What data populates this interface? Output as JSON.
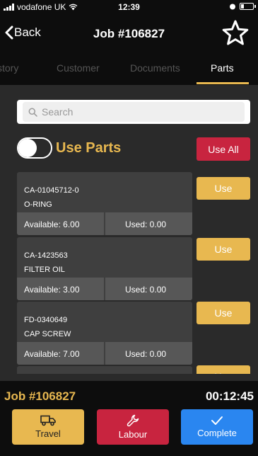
{
  "status_bar": {
    "carrier": "vodafone UK",
    "time": "12:39"
  },
  "nav": {
    "back_label": "Back",
    "title": "Job #106827"
  },
  "tabs": [
    {
      "label": "story",
      "active": false
    },
    {
      "label": "Customer",
      "active": false
    },
    {
      "label": "Documents",
      "active": false
    },
    {
      "label": "Parts",
      "active": true
    }
  ],
  "search": {
    "placeholder": "Search",
    "value": ""
  },
  "use_parts": {
    "label": "Use Parts",
    "toggle_on": false,
    "use_all_label": "Use All"
  },
  "parts": [
    {
      "code": "CA-01045712-0",
      "name": "O-RING",
      "available": "Available: 6.00",
      "used": "Used: 0.00",
      "button": "Use"
    },
    {
      "code": "CA-1423563",
      "name": "FILTER OIL",
      "available": "Available: 3.00",
      "used": "Used: 0.00",
      "button": "Use"
    },
    {
      "code": "FD-0340649",
      "name": "CAP SCREW",
      "available": "Available: 7.00",
      "used": "Used: 0.00",
      "button": "Use"
    },
    {
      "code": "",
      "name": "",
      "available": "",
      "used": "",
      "button": "Use"
    }
  ],
  "footer": {
    "job": "Job #106827",
    "timer": "00:12:45",
    "actions": {
      "travel": "Travel",
      "labour": "Labour",
      "complete": "Complete"
    }
  },
  "colors": {
    "accent": "#e8b850",
    "danger": "#c8243f",
    "primary": "#2a86f0",
    "background": "#2a2a2a"
  }
}
